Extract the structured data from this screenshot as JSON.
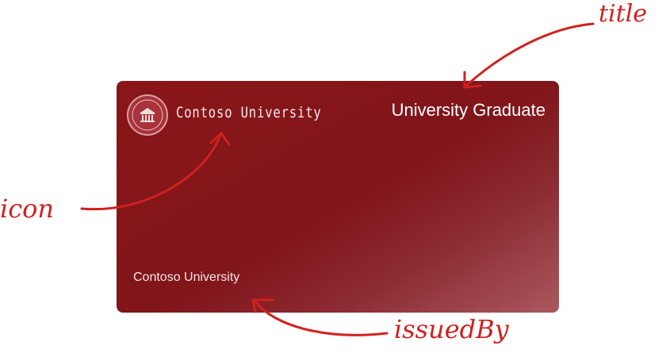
{
  "card": {
    "logo_text": "Contoso University",
    "title": "University Graduate",
    "issued_by": "Contoso University"
  },
  "annotations": {
    "title_label": "title",
    "icon_label": "icon",
    "issued_by_label": "issuedBy"
  },
  "colors": {
    "card_primary": "#80151a",
    "card_gradient_end": "#a9585e",
    "annotation": "#d0211f",
    "card_text": "#ffffff"
  },
  "icons": {
    "logo": "university-seal-icon"
  }
}
